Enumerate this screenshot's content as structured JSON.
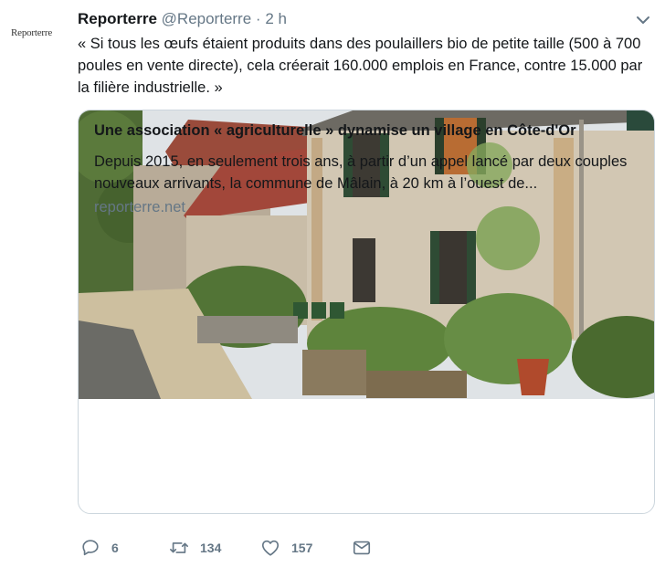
{
  "author": {
    "avatar_text": "Reporterre",
    "name": "Reporterre",
    "handle": "@Reporterre",
    "separator": "·",
    "time": "2 h"
  },
  "tweet": {
    "text": "« Si tous les œufs étaient produits dans des poulaillers bio de petite taille (500 à 700 poules en vente directe), cela créerait 160.000 emplois en France, contre 15.000 par la filière industrielle. »"
  },
  "card": {
    "title": "Une association « agriculturelle » dynamise un village en Côte-d'Or",
    "description": "Depuis 2015, en seulement trois ans, à partir d’un appel lancé par deux couples nouveaux arrivants, la commune de Mâlain, à 20 km à l’ouest de...",
    "domain": "reporterre.net"
  },
  "actions": {
    "reply_count": "6",
    "retweet_count": "134",
    "like_count": "157"
  },
  "colors": {
    "text": "#14171a",
    "secondary": "#657786",
    "border": "#ccd6dd",
    "brand_accent": "#c0392b"
  },
  "icons": [
    "caret-down-icon",
    "reply-icon",
    "retweet-icon",
    "heart-icon",
    "envelope-icon"
  ]
}
